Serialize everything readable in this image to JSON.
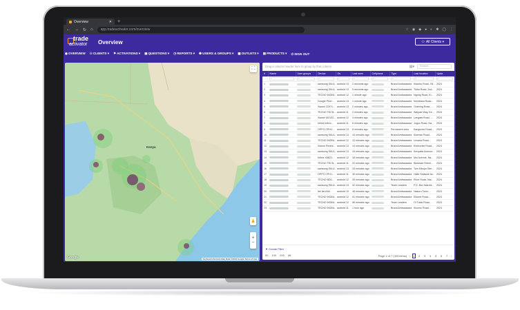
{
  "browser": {
    "tab_title": "Overview",
    "url": "app.tradeactivator.com/overview"
  },
  "app": {
    "logo_line1": "trade",
    "logo_line2": "activator",
    "page_title": "Overview",
    "clients_button": "All Clients ▾"
  },
  "nav": [
    {
      "icon": "dashboard-icon",
      "label": "OVERVIEW"
    },
    {
      "icon": "clients-icon",
      "label": "CLIENTS ▾"
    },
    {
      "icon": "activations-icon",
      "label": "ACTIVATIONS ▾"
    },
    {
      "icon": "questions-icon",
      "label": "QUESTIONS ▾"
    },
    {
      "icon": "reports-icon",
      "label": "REPORTS ▾"
    },
    {
      "icon": "users-icon",
      "label": "USERS & GROUPS ▾"
    },
    {
      "icon": "outlets-icon",
      "label": "OUTLETS ▾"
    },
    {
      "icon": "products-icon",
      "label": "PRODUCTS ▾"
    },
    {
      "icon": "signout-icon",
      "label": "SIGN OUT"
    }
  ],
  "map": {
    "country_label": "Kenya",
    "zoom_in": "+",
    "zoom_out": "−",
    "attribution": "Keyboard shortcuts   Map Data ©2024 Google   Terms of Use",
    "google": "Google"
  },
  "grid": {
    "group_hint": "Drag a column header here to group by that column",
    "search_placeholder": "Search...",
    "columns": [
      "#",
      "Name",
      "User groups",
      "Device",
      "Os",
      "Last seen",
      "Cellphone",
      "Type",
      "Last location",
      "Upda"
    ],
    "rows": [
      {
        "n": "1",
        "device": "samsung SM-A...",
        "os": "android 13",
        "seen": "2 seconds ago",
        "type": "Brand Ambassador a...",
        "loc": "Kiambu Road, Gil...",
        "upd": "2024"
      },
      {
        "n": "2",
        "device": "samsung SM-A...",
        "os": "android 13",
        "seen": "5 seconds ago",
        "type": "Brand Ambassador a...",
        "loc": "Thika Road, 2nd...",
        "upd": "2024"
      },
      {
        "n": "3",
        "device": "TECNO MOBIL...",
        "os": "android 12",
        "seen": "1 minute ago",
        "type": "Brand Ambassador a...",
        "loc": "Ngong Road, Ki...",
        "upd": "2024"
      },
      {
        "n": "4",
        "device": "Google Pixel ...",
        "os": "android 13",
        "seen": "1 minute ago",
        "type": "Brand Ambassador a...",
        "loc": "Mombasa Road...",
        "upd": "2024"
      },
      {
        "n": "5",
        "device": "Xiaomi 22071...",
        "os": "android 13",
        "seen": "2 minutes ago",
        "type": "Brand Ambassador a...",
        "loc": "Outering Road, ...",
        "upd": "2024"
      },
      {
        "n": "6",
        "device": "TECNO TECN...",
        "os": "android 11",
        "seen": "2 minutes ago",
        "type": "Brand Ambassador a...",
        "loc": "Waiyaki Way, Ke...",
        "upd": "2024"
      },
      {
        "n": "7",
        "device": "Xiaomi M2102...",
        "os": "android 12",
        "seen": "4 minutes ago",
        "type": "Brand Ambassador a...",
        "loc": "Langata Road, ...",
        "upd": "2024"
      },
      {
        "n": "8",
        "device": "Infinix Infinix...",
        "os": "android 11",
        "seen": "6 minutes ago",
        "type": "Brand Ambassador a...",
        "loc": "Jogoo Road, Na...",
        "upd": "2024"
      },
      {
        "n": "9",
        "device": "OPPO CPH2...",
        "os": "android 13",
        "seen": "8 minutes ago",
        "type": "Permanent area",
        "loc": "Kangundo Road...",
        "upd": "2024"
      },
      {
        "n": "10",
        "device": "samsung SM-A...",
        "os": "android 13",
        "seen": "10 minutes ago",
        "type": "Brand Ambassador a...",
        "loc": "Kiserian Road...",
        "upd": "2024"
      },
      {
        "n": "11",
        "device": "TECNO MOBIL...",
        "os": "android 12",
        "seen": "12 minutes ago",
        "type": "Brand Ambassador a...",
        "loc": "Lenana Road...",
        "upd": "2024"
      },
      {
        "n": "12",
        "device": "Xiaomi Redmi...",
        "os": "android 13",
        "seen": "14 minutes ago",
        "type": "Brand Ambassador a...",
        "loc": "Enterprise Road...",
        "upd": "2024"
      },
      {
        "n": "13",
        "device": "samsung SM-A...",
        "os": "android 13",
        "seen": "15 minutes ago",
        "type": "Brand Ambassador a...",
        "loc": "Kenyatta Avenue...",
        "upd": "2024"
      },
      {
        "n": "14",
        "device": "Infinix X6823...",
        "os": "android 12",
        "seen": "18 minutes ago",
        "type": "Brand Ambassador a...",
        "loc": "Moi Avenue, Na...",
        "upd": "2024"
      },
      {
        "n": "15",
        "device": "TECNO TECN...",
        "os": "android 11",
        "seen": "22 minutes ago",
        "type": "Brand Ambassador a...",
        "loc": "Biashara Street...",
        "upd": "2024"
      },
      {
        "n": "16",
        "device": "samsung SM-A...",
        "os": "android 13",
        "seen": "25 minutes ago",
        "type": "Brand Ambassador a...",
        "loc": "Tom Mboya Stre...",
        "upd": "2024"
      },
      {
        "n": "17",
        "device": "OPPO CPH1...",
        "os": "android 11",
        "seen": "30 minutes ago",
        "type": "Brand Ambassador a...",
        "loc": "Haile Selassie Av...",
        "upd": "2024"
      },
      {
        "n": "18",
        "device": "TECNO BD4...",
        "os": "android 12",
        "seen": "35 minutes ago",
        "type": "Brand Ambassador a...",
        "loc": "River Road, Nai...",
        "upd": "2024"
      },
      {
        "n": "19",
        "device": "samsung SM-A...",
        "os": "android 13",
        "seen": "42 minutes ago",
        "type": "Team Leaders",
        "loc": "P.O. Box Nairobi...",
        "upd": "2024"
      },
      {
        "n": "20",
        "device": "Itel itel A66...",
        "os": "android 10",
        "seen": "48 minutes ago",
        "type": "Brand Ambassador a...",
        "loc": "Nakuru Town...",
        "upd": "2024"
      },
      {
        "n": "21",
        "device": "TECNO MOBIL...",
        "os": "android 12",
        "seen": "51 minutes ago",
        "type": "Brand Ambassador a...",
        "loc": "Eldoret Road...",
        "upd": "2024"
      },
      {
        "n": "22",
        "device": "TECNO MOBIL...",
        "os": "android 12",
        "seen": "56 minutes ago",
        "type": "Team Leaders",
        "loc": "Ol Tukai Road...",
        "upd": "2024"
      },
      {
        "n": "23",
        "device": "TECNO MOBIL...",
        "os": "android 11",
        "seen": "1 hour ago",
        "type": "Brand Ambassador a...",
        "loc": "Kisumu Road...",
        "upd": "2024"
      }
    ],
    "filter_label": "Create Filter",
    "page_sizes": [
      "50",
      "100",
      "200",
      "All"
    ],
    "page_info": "Page 1 of 7 (305 items)",
    "pages": [
      "1",
      "2",
      "3",
      "4",
      "5",
      "6",
      "7"
    ]
  }
}
